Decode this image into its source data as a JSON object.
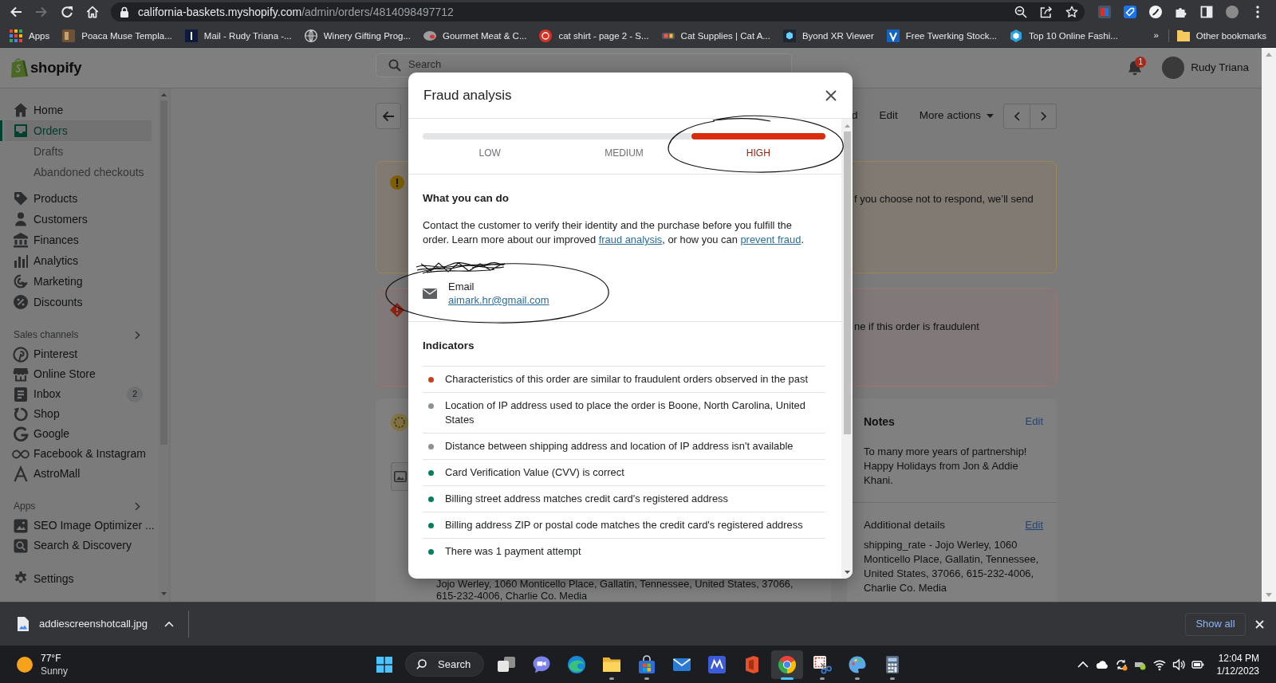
{
  "browser": {
    "nav_buttons": [
      {
        "disabled": false
      },
      {
        "disabled": true
      }
    ],
    "url_host": "california-baskets.myshopify.com",
    "url_path": "/admin/orders/4814098497712",
    "bookmarks": [
      {
        "label": "Apps"
      },
      {
        "label": "Poaca Muse Templa..."
      },
      {
        "label": "Mail - Rudy Triana -..."
      },
      {
        "label": "Winery Gifting Prog..."
      },
      {
        "label": "Gourmet Meat & C..."
      },
      {
        "label": "cat shirt - page 2 - S..."
      },
      {
        "label": "Cat Supplies | Cat A..."
      },
      {
        "label": "Byond XR Viewer"
      },
      {
        "label": "Free Twerking Stock..."
      },
      {
        "label": "Top 10 Online Fashi..."
      }
    ],
    "bookmarks_overflow": "»",
    "other_bookmarks": "Other bookmarks"
  },
  "admin": {
    "logo": "shopify",
    "search": {
      "placeholder": "Search"
    },
    "notification_count": "1",
    "user_name": "Rudy Triana",
    "sidebar": {
      "groups": [
        {
          "items": [
            {
              "label": "Home",
              "selected": false
            },
            {
              "label": "Orders",
              "selected": true,
              "children": [
                {
                  "label": "Drafts",
                  "selected": false
                },
                {
                  "label": "Abandoned checkouts",
                  "selected": false
                }
              ]
            },
            {
              "label": "Products",
              "selected": false
            },
            {
              "label": "Customers",
              "selected": false
            },
            {
              "label": "Finances",
              "selected": false
            },
            {
              "label": "Analytics",
              "selected": false
            },
            {
              "label": "Marketing",
              "selected": false
            },
            {
              "label": "Discounts",
              "selected": false
            }
          ]
        },
        {
          "heading": "Sales channels",
          "items": [
            {
              "label": "Pinterest",
              "selected": false
            },
            {
              "label": "Online Store",
              "selected": false
            },
            {
              "label": "Inbox",
              "selected": false,
              "badge": "2"
            },
            {
              "label": "Shop",
              "selected": false
            },
            {
              "label": "Google",
              "selected": false
            },
            {
              "label": "Facebook & Instagram",
              "selected": false
            },
            {
              "label": "AstroMall",
              "selected": false
            }
          ]
        },
        {
          "heading": "Apps",
          "items": [
            {
              "label": "SEO Image Optimizer ...",
              "selected": false
            },
            {
              "label": "Search & Discovery",
              "selected": false
            }
          ]
        },
        {
          "items": [
            {
              "label": "Settings",
              "selected": false
            }
          ]
        }
      ]
    },
    "page": {
      "header_actions": [
        {
          "kind": "button",
          "label": "d"
        },
        {
          "kind": "button",
          "label": "Edit"
        },
        {
          "kind": "menu",
          "label": "More actions"
        }
      ],
      "banners": [
        {
          "kind": "warning",
          "text": "f you choose not to respond, we’ll send"
        },
        {
          "kind": "critical",
          "text": "ne if this order is fraudulent"
        }
      ],
      "order_card": {
        "address": "Jojo Werley, 1060 Monticello Place, Gallatin, Tennessee, United States, 37066, 615-232-4006, Charlie Co. Media"
      },
      "notes": {
        "title": "Notes",
        "edit": "Edit",
        "text": "To many more years of partnership! Happy Holidays from Jon & Addie Khani."
      },
      "additional_details": {
        "title": "Additional details",
        "edit": "Edit",
        "text": "shipping_rate - Jojo Werley, 1060 Monticello Place, Gallatin, Tennessee, United States, 37066, 615-232-4006, Charlie Co. Media"
      }
    }
  },
  "fraud_analysis": {
    "title": "Fraud analysis",
    "risk_levels": [
      {
        "label": "LOW",
        "selected": false
      },
      {
        "label": "MEDIUM",
        "selected": false
      },
      {
        "label": "HIGH",
        "selected": true
      }
    ],
    "actions_heading": "What you can do",
    "actions_text": [
      {
        "kind": "text",
        "text": "Contact the customer to verify their identity and the purchase before you fulfill the order. Learn more about our improved "
      },
      {
        "kind": "link",
        "text": "fraud analysis"
      },
      {
        "kind": "text",
        "text": ", or how you can "
      },
      {
        "kind": "link",
        "text": "prevent fraud"
      },
      {
        "kind": "text",
        "text": "."
      }
    ],
    "contact": {
      "label": "Email",
      "value": "aimark.hr@gmail.com"
    },
    "indicators_heading": "Indicators",
    "indicators": [
      {
        "color": "#cc3f1c",
        "text": "Characteristics of this order are similar to fraudulent orders observed in the past"
      },
      {
        "color": "#8c9196",
        "text": "Location of IP address used to place the order is Boone, North Carolina, United States"
      },
      {
        "color": "#8c9196",
        "text": "Distance between shipping address and location of IP address isn't available"
      },
      {
        "color": "#007f5f",
        "text": "Card Verification Value (CVV) is correct"
      },
      {
        "color": "#007f5f",
        "text": "Billing street address matches credit card's registered address"
      },
      {
        "color": "#007f5f",
        "text": "Billing address ZIP or postal code matches the credit card's registered address"
      },
      {
        "color": "#007f5f",
        "text": "There was 1 payment attempt"
      }
    ]
  },
  "downloads": {
    "file_name": "addiescreenshotcall.jpg",
    "show_all": "Show all"
  },
  "taskbar": {
    "weather": {
      "temperature": "77°F",
      "condition": "Sunny"
    },
    "search_label": "Search",
    "apps": [
      {
        "selected": false,
        "running": false
      },
      {
        "selected": false,
        "running": false
      },
      {
        "selected": false,
        "running": false
      },
      {
        "selected": false,
        "running": true
      },
      {
        "selected": false,
        "running": true
      },
      {
        "selected": false,
        "running": false
      },
      {
        "selected": false,
        "running": false
      },
      {
        "selected": false,
        "running": false
      },
      {
        "selected": true,
        "running": true
      },
      {
        "selected": false,
        "running": true
      },
      {
        "selected": false,
        "running": true
      },
      {
        "selected": false,
        "running": true
      }
    ],
    "time": "12:04 PM",
    "date": "1/12/2023"
  }
}
